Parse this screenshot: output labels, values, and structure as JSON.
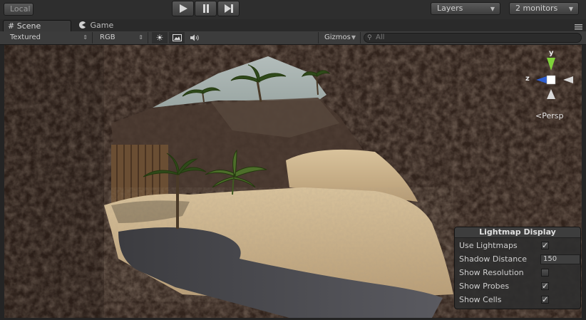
{
  "toolbar_top": {
    "layout_button": "Local",
    "play_icon": "play-icon",
    "pause_icon": "pause-icon",
    "step_icon": "step-icon",
    "layers_dropdown": "Layers",
    "layout_dropdown": "2 monitors"
  },
  "tabs": [
    {
      "label": "Scene",
      "active": true,
      "icon": "scene-grid-icon"
    },
    {
      "label": "Game",
      "active": false,
      "icon": "game-pacman-icon"
    }
  ],
  "scene_toolbar": {
    "draw_mode": "Textured",
    "render_mode": "RGB",
    "lighting_icon": "sun-icon",
    "image_icon": "image-icon",
    "audio_icon": "audio-icon",
    "gizmos_label": "Gizmos",
    "search_placeholder": "All"
  },
  "gizmo": {
    "y_label": "y",
    "z_label": "z",
    "persp_label": "Persp"
  },
  "lightmap_panel": {
    "title": "Lightmap Display",
    "rows": [
      {
        "label": "Use Lightmaps",
        "type": "checkbox",
        "checked": true
      },
      {
        "label": "Shadow Distance",
        "type": "field",
        "value": "150"
      },
      {
        "label": "Show Resolution",
        "type": "checkbox",
        "checked": false
      },
      {
        "label": "Show Probes",
        "type": "checkbox",
        "checked": true
      },
      {
        "label": "Show Cells",
        "type": "checkbox",
        "checked": true
      }
    ]
  },
  "colors": {
    "sand": "#c9b08a",
    "rock": "#3a2a22",
    "water": "#4a4a4e",
    "sky": "#a9b6b4",
    "palm": "#2f4a1a"
  }
}
